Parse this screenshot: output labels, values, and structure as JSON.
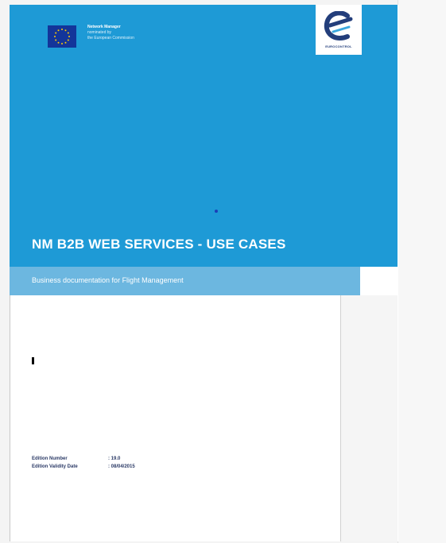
{
  "header": {
    "eu_block": {
      "line1": "Network Manager",
      "line2": "nominated by",
      "line3": "the European Commission"
    },
    "logo": {
      "caption": "EUROCONTROL",
      "icon": "eurocontrol-logo-icon"
    },
    "flag_icon": "eu-flag-icon"
  },
  "document": {
    "title": "NM B2B WEB SERVICES - USE CASES",
    "subtitle": "Business documentation for Flight Management"
  },
  "metadata": {
    "edition_number_label": "Edition Number",
    "edition_number_value": ": 19.0",
    "edition_validity_label": "Edition Validity Date",
    "edition_validity_value": ": 08/04/2015"
  },
  "colors": {
    "cover_blue": "#1e9ad6",
    "subtitle_blue": "#6cb7e0",
    "eu_blue": "#13359a",
    "logo_navy": "#233e7b"
  }
}
